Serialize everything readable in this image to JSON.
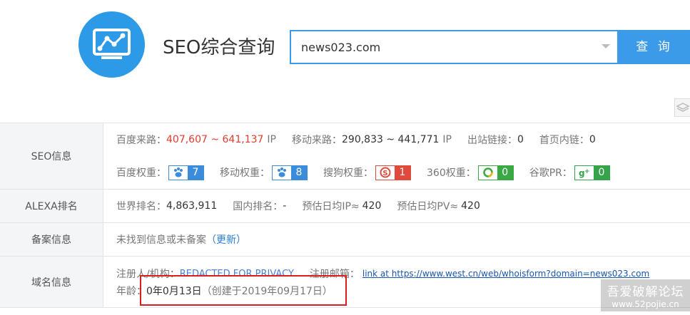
{
  "header": {
    "brand_title": "SEO综合查询",
    "search_value": "news023.com",
    "search_button": "查 询",
    "logo_icon": "chart-monitor-icon"
  },
  "colors": {
    "accent": "#3b9be8",
    "red": "#e23b2c",
    "baidu": "#3b8ddb",
    "sogou": "#e04a3c",
    "green": "#3aa845"
  },
  "seo": {
    "label": "SEO信息",
    "baidu_source_label": "百度来路：",
    "baidu_source_value": "407,607 ~ 641,137",
    "baidu_source_unit": "IP",
    "mobile_source_label": "移动来路：",
    "mobile_source_value": "290,833 ~ 441,771",
    "mobile_source_unit": "IP",
    "outlinks_label": "出站链接：",
    "outlinks_value": "0",
    "homelinks_label": "首页内链：",
    "homelinks_value": "0",
    "baidu_weight_label": "百度权重：",
    "baidu_weight_value": "7",
    "mobile_weight_label": "移动权重：",
    "mobile_weight_value": "8",
    "sogou_weight_label": "搜狗权重：",
    "sogou_weight_value": "1",
    "s360_weight_label": "360权重：",
    "s360_weight_value": "0",
    "google_pr_label": "谷歌PR：",
    "google_pr_value": "0"
  },
  "alexa": {
    "label": "ALEXA排名",
    "world_label": "世界排名：",
    "world_value": "4,863,911",
    "domestic_label": "国内排名：",
    "domestic_value": "-",
    "ip_label": "预估日均IP≈",
    "ip_value": "420",
    "pv_label": "预估日均PV≈",
    "pv_value": "420"
  },
  "icp": {
    "label": "备案信息",
    "text": "未找到信息或未备案",
    "update_open": "（",
    "update_link": "更新",
    "update_close": "）"
  },
  "domain": {
    "label": "域名信息",
    "registrant_label": "注册人/机构：",
    "registrant_value": "REDACTED FOR PRIVACY",
    "email_label": "注册邮箱：",
    "email_link": "link at https://www.west.cn/web/whoisform?domain=news023.com",
    "age_label": "年龄：",
    "age_value": "0年0月13日",
    "created_text": "（创建于2019年09月17日）"
  },
  "watermark": {
    "line1": "吾爱破解论坛",
    "line2": "www.52pojie.cn"
  }
}
